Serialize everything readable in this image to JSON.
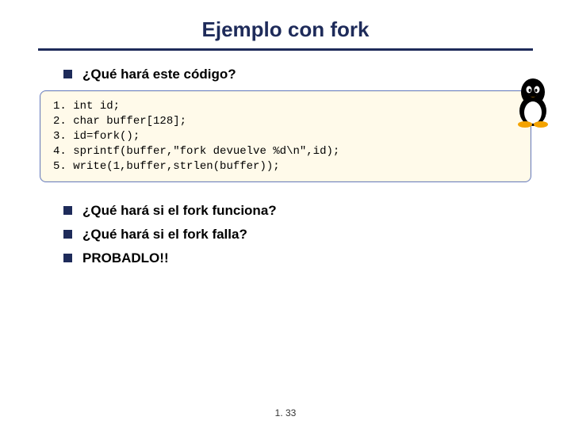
{
  "title": "Ejemplo con fork",
  "bullets_top": [
    "¿Qué hará este código?"
  ],
  "code": {
    "lines": [
      {
        "n": "1.",
        "text": "int id;"
      },
      {
        "n": "2.",
        "text": "char buffer[128];"
      },
      {
        "n": "3.",
        "text": "id=fork();"
      },
      {
        "n": "4.",
        "text": "sprintf(buffer,\"fork devuelve %d\\n\",id);"
      },
      {
        "n": "5.",
        "text": "write(1,buffer,strlen(buffer));"
      }
    ]
  },
  "bullets_bottom": [
    "¿Qué hará si el fork funciona?",
    "¿Qué hará si el fork falla?",
    "PROBADLO!!"
  ],
  "footer": "1. 33",
  "icons": {
    "tux": "tux-linux-penguin"
  }
}
